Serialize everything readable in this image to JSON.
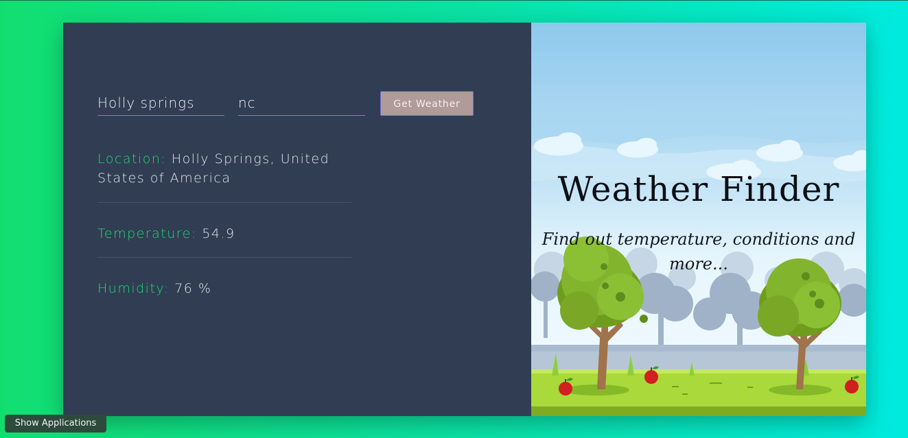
{
  "form": {
    "city_value": "Holly springs",
    "country_value": "nc",
    "button_label": "Get Weather"
  },
  "results": {
    "location_label": "Location:",
    "location_value": "Holly Springs, United States of America",
    "temperature_label": "Temperature:",
    "temperature_value": "54.9",
    "humidity_label": "Humidity:",
    "humidity_value": "76 %"
  },
  "hero": {
    "title": "Weather Finder",
    "subtitle": "Find out temperature, conditions and more..."
  },
  "taskbar": {
    "show_apps_label": "Show Applications"
  },
  "colors": {
    "accent_green": "#1ddc75",
    "panel_bg": "#313d53",
    "button_bg": "#b09a9a"
  }
}
